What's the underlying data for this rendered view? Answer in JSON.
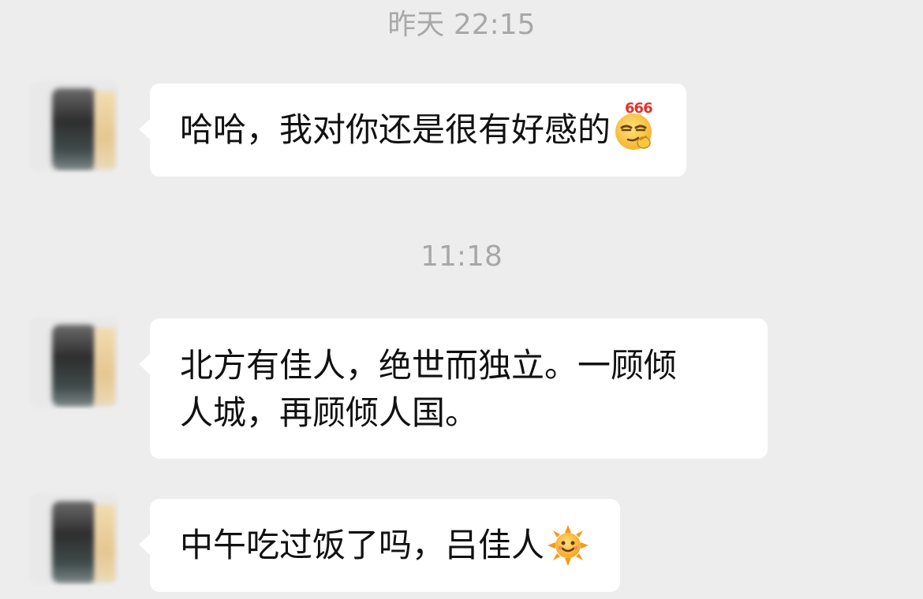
{
  "chat": {
    "groups": [
      {
        "timestamp": "昨天 22:15",
        "messages": [
          {
            "text": "哈哈，我对你还是很有好感的",
            "emoji": "smirk-666-emoji",
            "emoji_text": "666"
          }
        ]
      },
      {
        "timestamp": "11:18",
        "messages": [
          {
            "lines": [
              "北方有佳人，绝世而独立。一顾倾",
              "人城，再顾倾人国。"
            ]
          },
          {
            "text": "中午吃过饭了吗，吕佳人",
            "emoji": "sun-emoji"
          }
        ]
      }
    ]
  },
  "colors": {
    "background": "#ededed",
    "bubble": "#ffffff",
    "timestamp": "#a8a8a8",
    "text": "#111111"
  }
}
